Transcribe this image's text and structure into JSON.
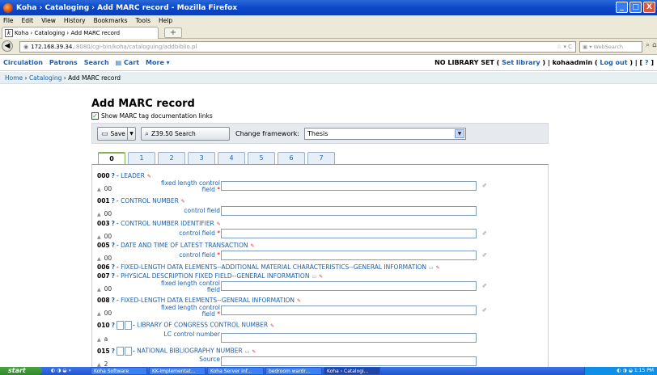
{
  "window": {
    "title": "Koha › Cataloging › Add MARC record - Mozilla Firefox",
    "controls": [
      "_",
      "□",
      "X"
    ]
  },
  "menubar": [
    "File",
    "Edit",
    "View",
    "History",
    "Bookmarks",
    "Tools",
    "Help"
  ],
  "browser_tab": {
    "title": "Koha › Cataloging › Add MARC record",
    "new_tab": "+"
  },
  "navbar": {
    "url_host": "172.168.39.34.",
    "url_rest": ":8080/cgi-bin/koha/cataloguing/addbiblio.pl",
    "search_placeholder": "WebSearch",
    "url_controls": "☆ ▾ C"
  },
  "koha_nav": {
    "links": [
      "Circulation",
      "Patrons",
      "Search",
      "Cart",
      "More ▾"
    ],
    "library_status": "NO LIBRARY SET",
    "set_library": "Set library",
    "user": "kohaadmin",
    "logout": "Log out",
    "help": "?"
  },
  "breadcrumb": {
    "home": "Home",
    "cataloging": "Cataloging",
    "current": "Add MARC record"
  },
  "page": {
    "title": "Add MARC record",
    "show_docs_label": "Show MARC tag documentation links",
    "save_label": "Save",
    "z3950_label": "Z39.50 Search",
    "framework_label": "Change framework:",
    "framework_value": "Thesis"
  },
  "tabs": [
    "0",
    "1",
    "2",
    "3",
    "4",
    "5",
    "6",
    "7"
  ],
  "fields": [
    {
      "tag": "000",
      "name": "LEADER",
      "sub_code": "00",
      "sub_label": "fixed length control field",
      "required": true
    },
    {
      "tag": "001",
      "name": "CONTROL NUMBER",
      "sub_code": "00",
      "sub_label": "control field",
      "required": false
    },
    {
      "tag": "003",
      "name": "CONTROL NUMBER IDENTIFIER",
      "sub_code": "00",
      "sub_label": "control field",
      "required": true
    },
    {
      "tag": "005",
      "name": "DATE AND TIME OF LATEST TRANSACTION",
      "sub_code": "00",
      "sub_label": "control field",
      "required": true
    },
    {
      "tag": "006",
      "name": "FIXED-LENGTH DATA ELEMENTS--ADDITIONAL MATERIAL CHARACTERISTICS--GENERAL INFORMATION"
    },
    {
      "tag": "007",
      "name": "PHYSICAL DESCRIPTION FIXED FIELD--GENERAL INFORMATION",
      "sub_code": "00",
      "sub_label": "fixed length control field",
      "required": false
    },
    {
      "tag": "008",
      "name": "FIXED-LENGTH DATA ELEMENTS--GENERAL INFORMATION",
      "sub_code": "00",
      "sub_label": "fixed length control field",
      "required": true
    },
    {
      "tag": "010",
      "name": "LIBRARY OF CONGRESS CONTROL NUMBER",
      "sub_code": "a",
      "sub_label": "LC control number",
      "required": false
    },
    {
      "tag": "015",
      "name": "NATIONAL BIBLIOGRAPHY NUMBER",
      "sub_code": "2",
      "sub_label": "Source",
      "required": false
    }
  ],
  "taskbar": {
    "start": "start",
    "items": [
      "Koha Software",
      "KK-Implementat...",
      "Koha Server inf...",
      "bedroom wardr...",
      "Koha › Catalogi..."
    ],
    "clock": "1:15 PM"
  }
}
